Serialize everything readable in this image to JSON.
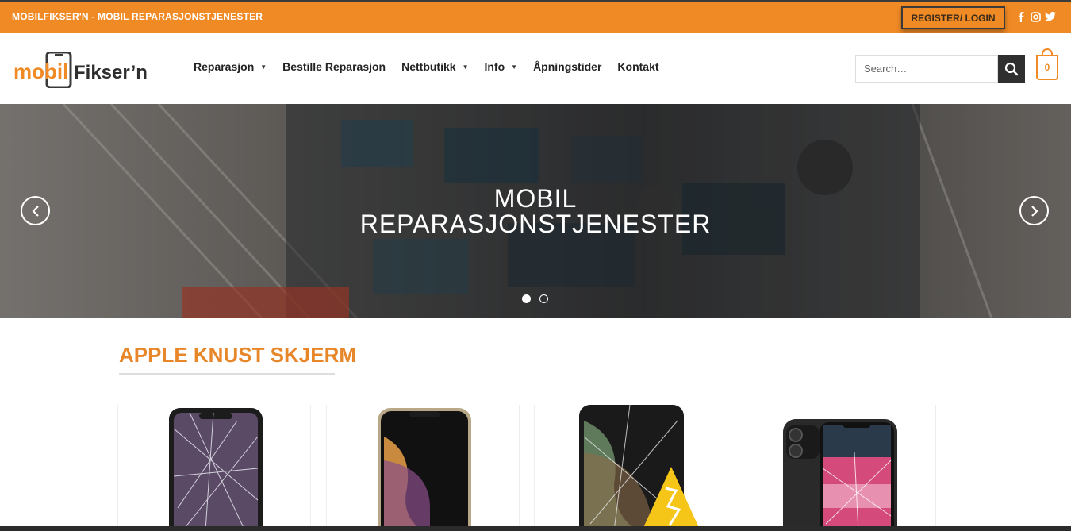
{
  "topbar": {
    "title": "MOBILFIKSER'N - MOBIL REPARASJONSTJENESTER",
    "register_label": "REGISTER/ LOGIN",
    "social_icons": [
      "facebook-icon",
      "instagram-icon",
      "twitter-icon"
    ]
  },
  "header": {
    "logo_part1": "mobil",
    "logo_part2": "Fikser’n",
    "nav": [
      {
        "label": "Reparasjon",
        "has_dropdown": true
      },
      {
        "label": "Bestille Reparasjon",
        "has_dropdown": false
      },
      {
        "label": "Nettbutikk",
        "has_dropdown": true
      },
      {
        "label": "Info",
        "has_dropdown": true
      },
      {
        "label": "Åpningstider",
        "has_dropdown": false
      },
      {
        "label": "Kontakt",
        "has_dropdown": false
      }
    ],
    "search_placeholder": "Search…",
    "cart_count": "0"
  },
  "hero": {
    "title_line1": "MOBIL",
    "title_line2": "REPARASJONSTJENESTER",
    "slides": 2,
    "active_slide": 1
  },
  "section": {
    "title": "APPLE KNUST SKJERM"
  },
  "colors": {
    "accent": "#f08a24",
    "title_orange": "#e8862a",
    "dark": "#2f2f2f"
  }
}
